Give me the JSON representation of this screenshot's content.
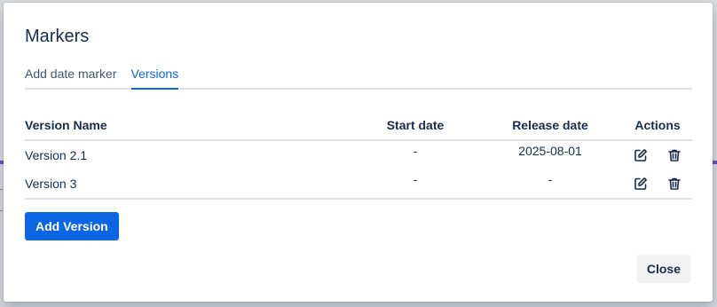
{
  "modal": {
    "title": "Markers"
  },
  "tabs": [
    {
      "label": "Add date marker",
      "active": false
    },
    {
      "label": "Versions",
      "active": true
    }
  ],
  "table": {
    "headers": {
      "name": "Version Name",
      "start": "Start date",
      "release": "Release date",
      "actions": "Actions"
    },
    "rows": [
      {
        "name": "Version 2.1",
        "start": "-",
        "release": "2025-08-01"
      },
      {
        "name": "Version 3",
        "start": "-",
        "release": "-"
      }
    ],
    "row_icons": [
      "edit-icon",
      "trash-icon"
    ]
  },
  "buttons": {
    "add_version": "Add Version",
    "close": "Close"
  },
  "colors": {
    "accent": "#0c66e4",
    "text": "#172b4d",
    "border": "#dfe1e6"
  }
}
